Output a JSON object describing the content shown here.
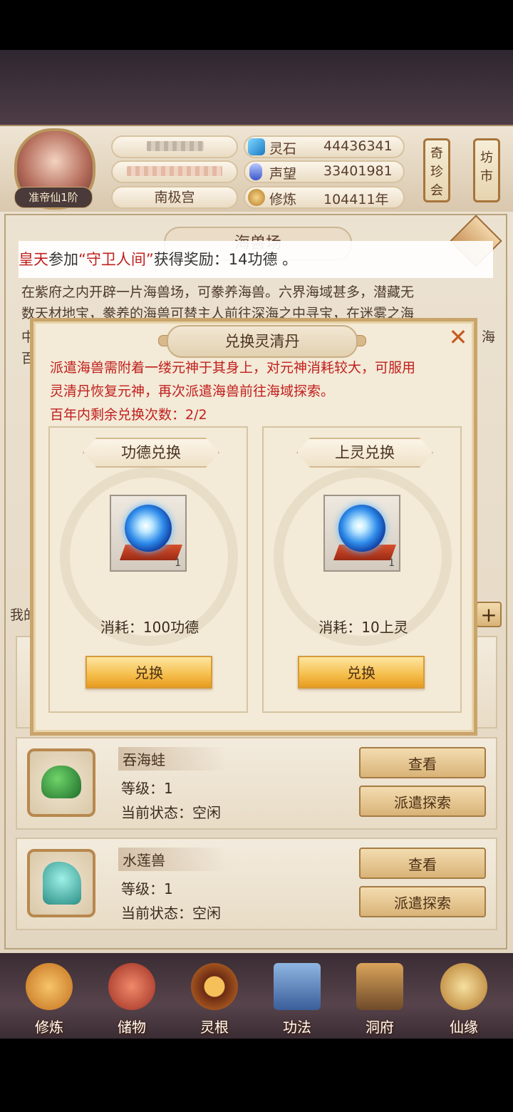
{
  "header": {
    "rank": "准帝仙1阶",
    "sect": "南极宫",
    "resources": [
      {
        "label": "灵石",
        "value": "44436341",
        "icon": "spirit-stone-icon",
        "color": "#2b9bd8"
      },
      {
        "label": "声望",
        "value": "33401981",
        "icon": "prestige-icon",
        "color": "#4a6fd8"
      },
      {
        "label": "修炼",
        "value": "104411年",
        "icon": "cultivate-icon",
        "color": "#c98a2e"
      }
    ],
    "side_buttons": [
      "奇珍会",
      "坊市"
    ]
  },
  "board": {
    "title": "海兽场",
    "notice": {
      "name": "皇天",
      "pre": "参加",
      "event": "“守卫人间”",
      "post": "获得奖励：14功德 。"
    },
    "intro_line1": "在紫府之内开辟一片海兽场，可豢养海兽。六界海域甚多，潜藏无",
    "intro_line2": "数天材地宝，豢养的海兽可替主人前往深海之中寻宝，在迷雾之海",
    "peek_left": [
      "中",
      "百"
    ],
    "peek_right": "海",
    "my_label_peek": "我的",
    "beasts": [
      {
        "name": "吞海蛙",
        "level_label": "等级：1",
        "status_label": "当前状态：空闲",
        "view": "查看",
        "dispatch": "派遣探索"
      },
      {
        "name": "水莲兽",
        "level_label": "等级：1",
        "status_label": "当前状态：空闲",
        "view": "查看",
        "dispatch": "派遣探索"
      }
    ]
  },
  "modal": {
    "title": "兑换灵清丹",
    "desc_line1": "派遣海兽需附着一缕元神于其身上，对元神消耗较大，可服用",
    "desc_line2": "灵清丹恢复元神，再次派遣海兽前往海域探索。",
    "remaining": "百年内剩余兑换次数：2/2",
    "cards": [
      {
        "title": "功德兑换",
        "qty": "1",
        "cost": "消耗：100功德",
        "button": "兑换"
      },
      {
        "title": "上灵兑换",
        "qty": "1",
        "cost": "消耗：10上灵",
        "button": "兑换"
      }
    ],
    "close_icon": "close-x-icon"
  },
  "nav": [
    {
      "label": "修炼",
      "icon": "meditation-icon"
    },
    {
      "label": "储物",
      "icon": "storage-bag-icon"
    },
    {
      "label": "灵根",
      "icon": "spirit-root-icon"
    },
    {
      "label": "功法",
      "icon": "technique-book-icon"
    },
    {
      "label": "洞府",
      "icon": "cave-mansion-icon"
    },
    {
      "label": "仙缘",
      "icon": "immortal-gourd-icon"
    }
  ]
}
